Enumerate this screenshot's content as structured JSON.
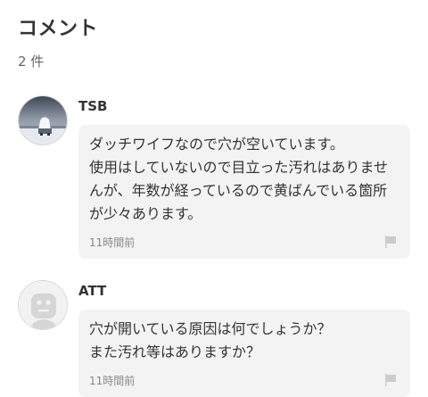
{
  "section": {
    "title": "コメント",
    "count": "2 件"
  },
  "comments": [
    {
      "username": "TSB",
      "avatar": "snow-car-photo",
      "text": "ダッチワイフなので穴が空いています。\n使用はしていないので目立った汚れはありませんが、年数が経っているので黄ばんでいる箇所が少々あります。",
      "timestamp": "11時間前",
      "report_icon": "flag-icon"
    },
    {
      "username": "ATT",
      "avatar": "default-user-icon",
      "text": "穴が開いている原因は何でしょうか？\nまた汚れ等はありますか？",
      "timestamp": "11時間前",
      "report_icon": "flag-icon"
    }
  ],
  "colors": {
    "bubble_bg": "#f3f3f3",
    "text": "#333333",
    "muted": "#888888",
    "flag": "#cccccc"
  }
}
